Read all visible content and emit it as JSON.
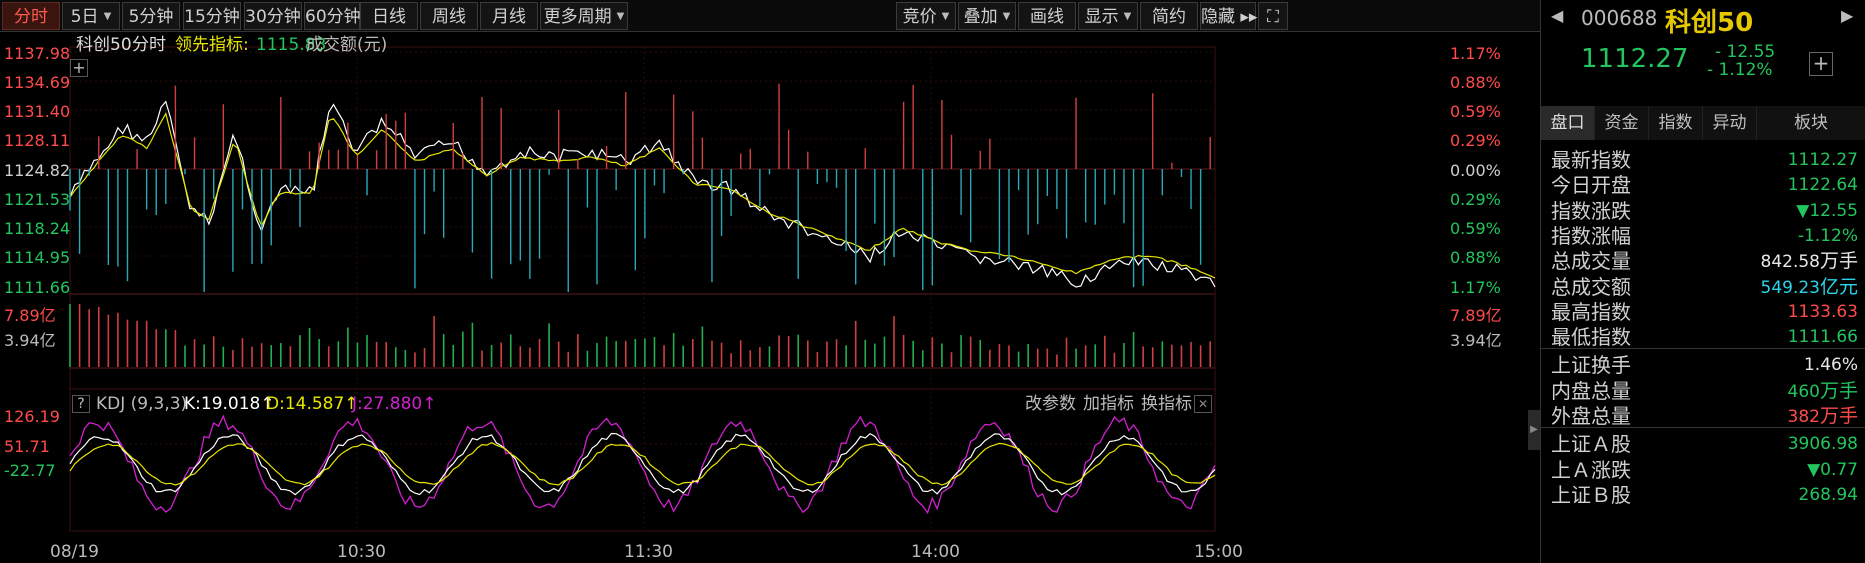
{
  "toolbar": {
    "items": [
      {
        "label": "分时",
        "active": true
      },
      {
        "label": "5日",
        "dropdown": true
      },
      {
        "label": "5分钟"
      },
      {
        "label": "15分钟"
      },
      {
        "label": "30分钟"
      },
      {
        "label": "60分钟"
      },
      {
        "label": "日线"
      },
      {
        "label": "周线"
      },
      {
        "label": "月线"
      },
      {
        "label": "更多周期",
        "dropdown": true
      },
      {
        "label": "竞价",
        "dropdown": true
      },
      {
        "label": "叠加",
        "dropdown": true
      },
      {
        "label": "画线"
      },
      {
        "label": "显示",
        "dropdown": true
      },
      {
        "label": "简约"
      },
      {
        "label": "隐藏 ▸▸"
      }
    ]
  },
  "legend": {
    "name": "科创50",
    "mode": "分时",
    "lead_label": "领先指标:",
    "lead_value": "1115.83",
    "turnover_label": "成交额(元)"
  },
  "price_axis": {
    "left": [
      "1137.98",
      "1134.69",
      "1131.40",
      "1128.11",
      "1124.82",
      "1121.53",
      "1118.24",
      "1114.95",
      "1111.66"
    ],
    "right": [
      "1.17%",
      "0.88%",
      "0.59%",
      "0.29%",
      "0.00%",
      "0.29%",
      "0.59%",
      "0.88%",
      "1.17%"
    ]
  },
  "volume_axis": {
    "top": "7.89亿",
    "mid": "3.94亿"
  },
  "kdj": {
    "help": "?",
    "name": "KDJ (9,3,3)",
    "k": "K:19.018↑",
    "d": "D:14.587↑",
    "j": "J:27.880↑",
    "buttons": [
      "改参数",
      "加指标",
      "换指标"
    ],
    "close": "✕",
    "axis": [
      "126.19",
      "51.71",
      "-22.77"
    ]
  },
  "time_axis": [
    "08/19",
    "10:30",
    "11:30",
    "14:00",
    "15:00"
  ],
  "colors": {
    "up": "#ff4b4b",
    "down": "#22c55e",
    "price_line": "#ffffff",
    "avg_line": "#e6e600",
    "teal": "#2aa8b8",
    "magenta": "#d020d0"
  },
  "side": {
    "code": "000688",
    "name": "科创50",
    "price": "1112.27",
    "change": "- 12.55",
    "change_pct": "- 1.12%",
    "tabs": [
      "盘口",
      "资金",
      "指数",
      "异动",
      "板块"
    ],
    "rows": [
      {
        "k": "最新指数",
        "v": "1112.27",
        "c": "down"
      },
      {
        "k": "今日开盘",
        "v": "1122.64",
        "c": "down"
      },
      {
        "k": "指数涨跌",
        "v": "▼12.55",
        "c": "down"
      },
      {
        "k": "指数涨幅",
        "v": "-1.12%",
        "c": "down"
      },
      {
        "k": "总成交量",
        "v": "842.58",
        "u": "万手",
        "c": "white"
      },
      {
        "k": "总成交额",
        "v": "549.23",
        "u": "亿元",
        "c": "teal"
      },
      {
        "k": "最高指数",
        "v": "1133.63",
        "c": "up"
      },
      {
        "k": "最低指数",
        "v": "1111.66",
        "c": "down"
      },
      {
        "k": "上证换手",
        "v": "1.46%",
        "c": "white"
      },
      {
        "k": "内盘总量",
        "v": "460",
        "u": "万手",
        "c": "down"
      },
      {
        "k": "外盘总量",
        "v": "382",
        "u": "万手",
        "c": "up"
      },
      {
        "k": "上证Ａ股",
        "v": "3906.98",
        "c": "down"
      },
      {
        "k": "上Ａ涨跌",
        "v": "▼0.77",
        "c": "down"
      },
      {
        "k": "上证Ｂ股",
        "v": "268.94",
        "c": "down"
      }
    ]
  }
}
